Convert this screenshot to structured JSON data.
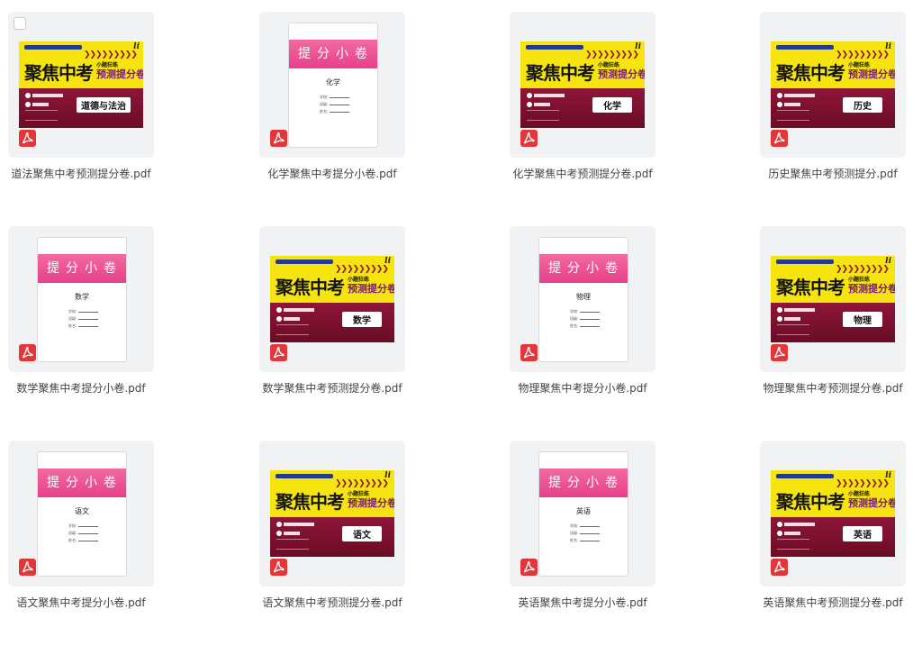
{
  "files": [
    {
      "name": "道法聚焦中考预测提分卷.pdf",
      "kind": "cover",
      "subject": "道德与法治"
    },
    {
      "name": "化学聚焦中考提分小卷.pdf",
      "kind": "booklet",
      "subject": "化学"
    },
    {
      "name": "化学聚焦中考预测提分卷.pdf",
      "kind": "cover",
      "subject": "化学"
    },
    {
      "name": "历史聚焦中考预测提分.pdf",
      "kind": "cover",
      "subject": "历史"
    },
    {
      "name": "数学聚焦中考提分小卷.pdf",
      "kind": "booklet",
      "subject": "数学"
    },
    {
      "name": "数学聚焦中考预测提分卷.pdf",
      "kind": "cover",
      "subject": "数学"
    },
    {
      "name": "物理聚焦中考提分小卷.pdf",
      "kind": "booklet",
      "subject": "物理"
    },
    {
      "name": "物理聚焦中考预测提分卷.pdf",
      "kind": "cover",
      "subject": "物理"
    },
    {
      "name": "语文聚焦中考提分小卷.pdf",
      "kind": "booklet",
      "subject": "语文"
    },
    {
      "name": "语文聚焦中考预测提分卷.pdf",
      "kind": "cover",
      "subject": "语文"
    },
    {
      "name": "英语聚焦中考提分小卷.pdf",
      "kind": "booklet",
      "subject": "英语"
    },
    {
      "name": "英语聚焦中考预测提分卷.pdf",
      "kind": "cover",
      "subject": "英语"
    }
  ],
  "cover": {
    "title": "聚焦中考",
    "edition": "小题狂练",
    "series": "预测提分卷",
    "logo_text": "li",
    "arrows": "❯❯❯❯❯❯❯❯❯"
  },
  "booklet": {
    "title": "提分小卷",
    "fields": [
      "学校:",
      "班级:",
      "姓名:"
    ]
  },
  "icons": {
    "file_type": "pdf-icon",
    "select": "checkbox-icon"
  },
  "colors": {
    "pdf_red": "#e2363a",
    "cover_yellow": "#f6e40e",
    "cover_magenta": "#7d1030",
    "booklet_pink": "#e7408a"
  }
}
